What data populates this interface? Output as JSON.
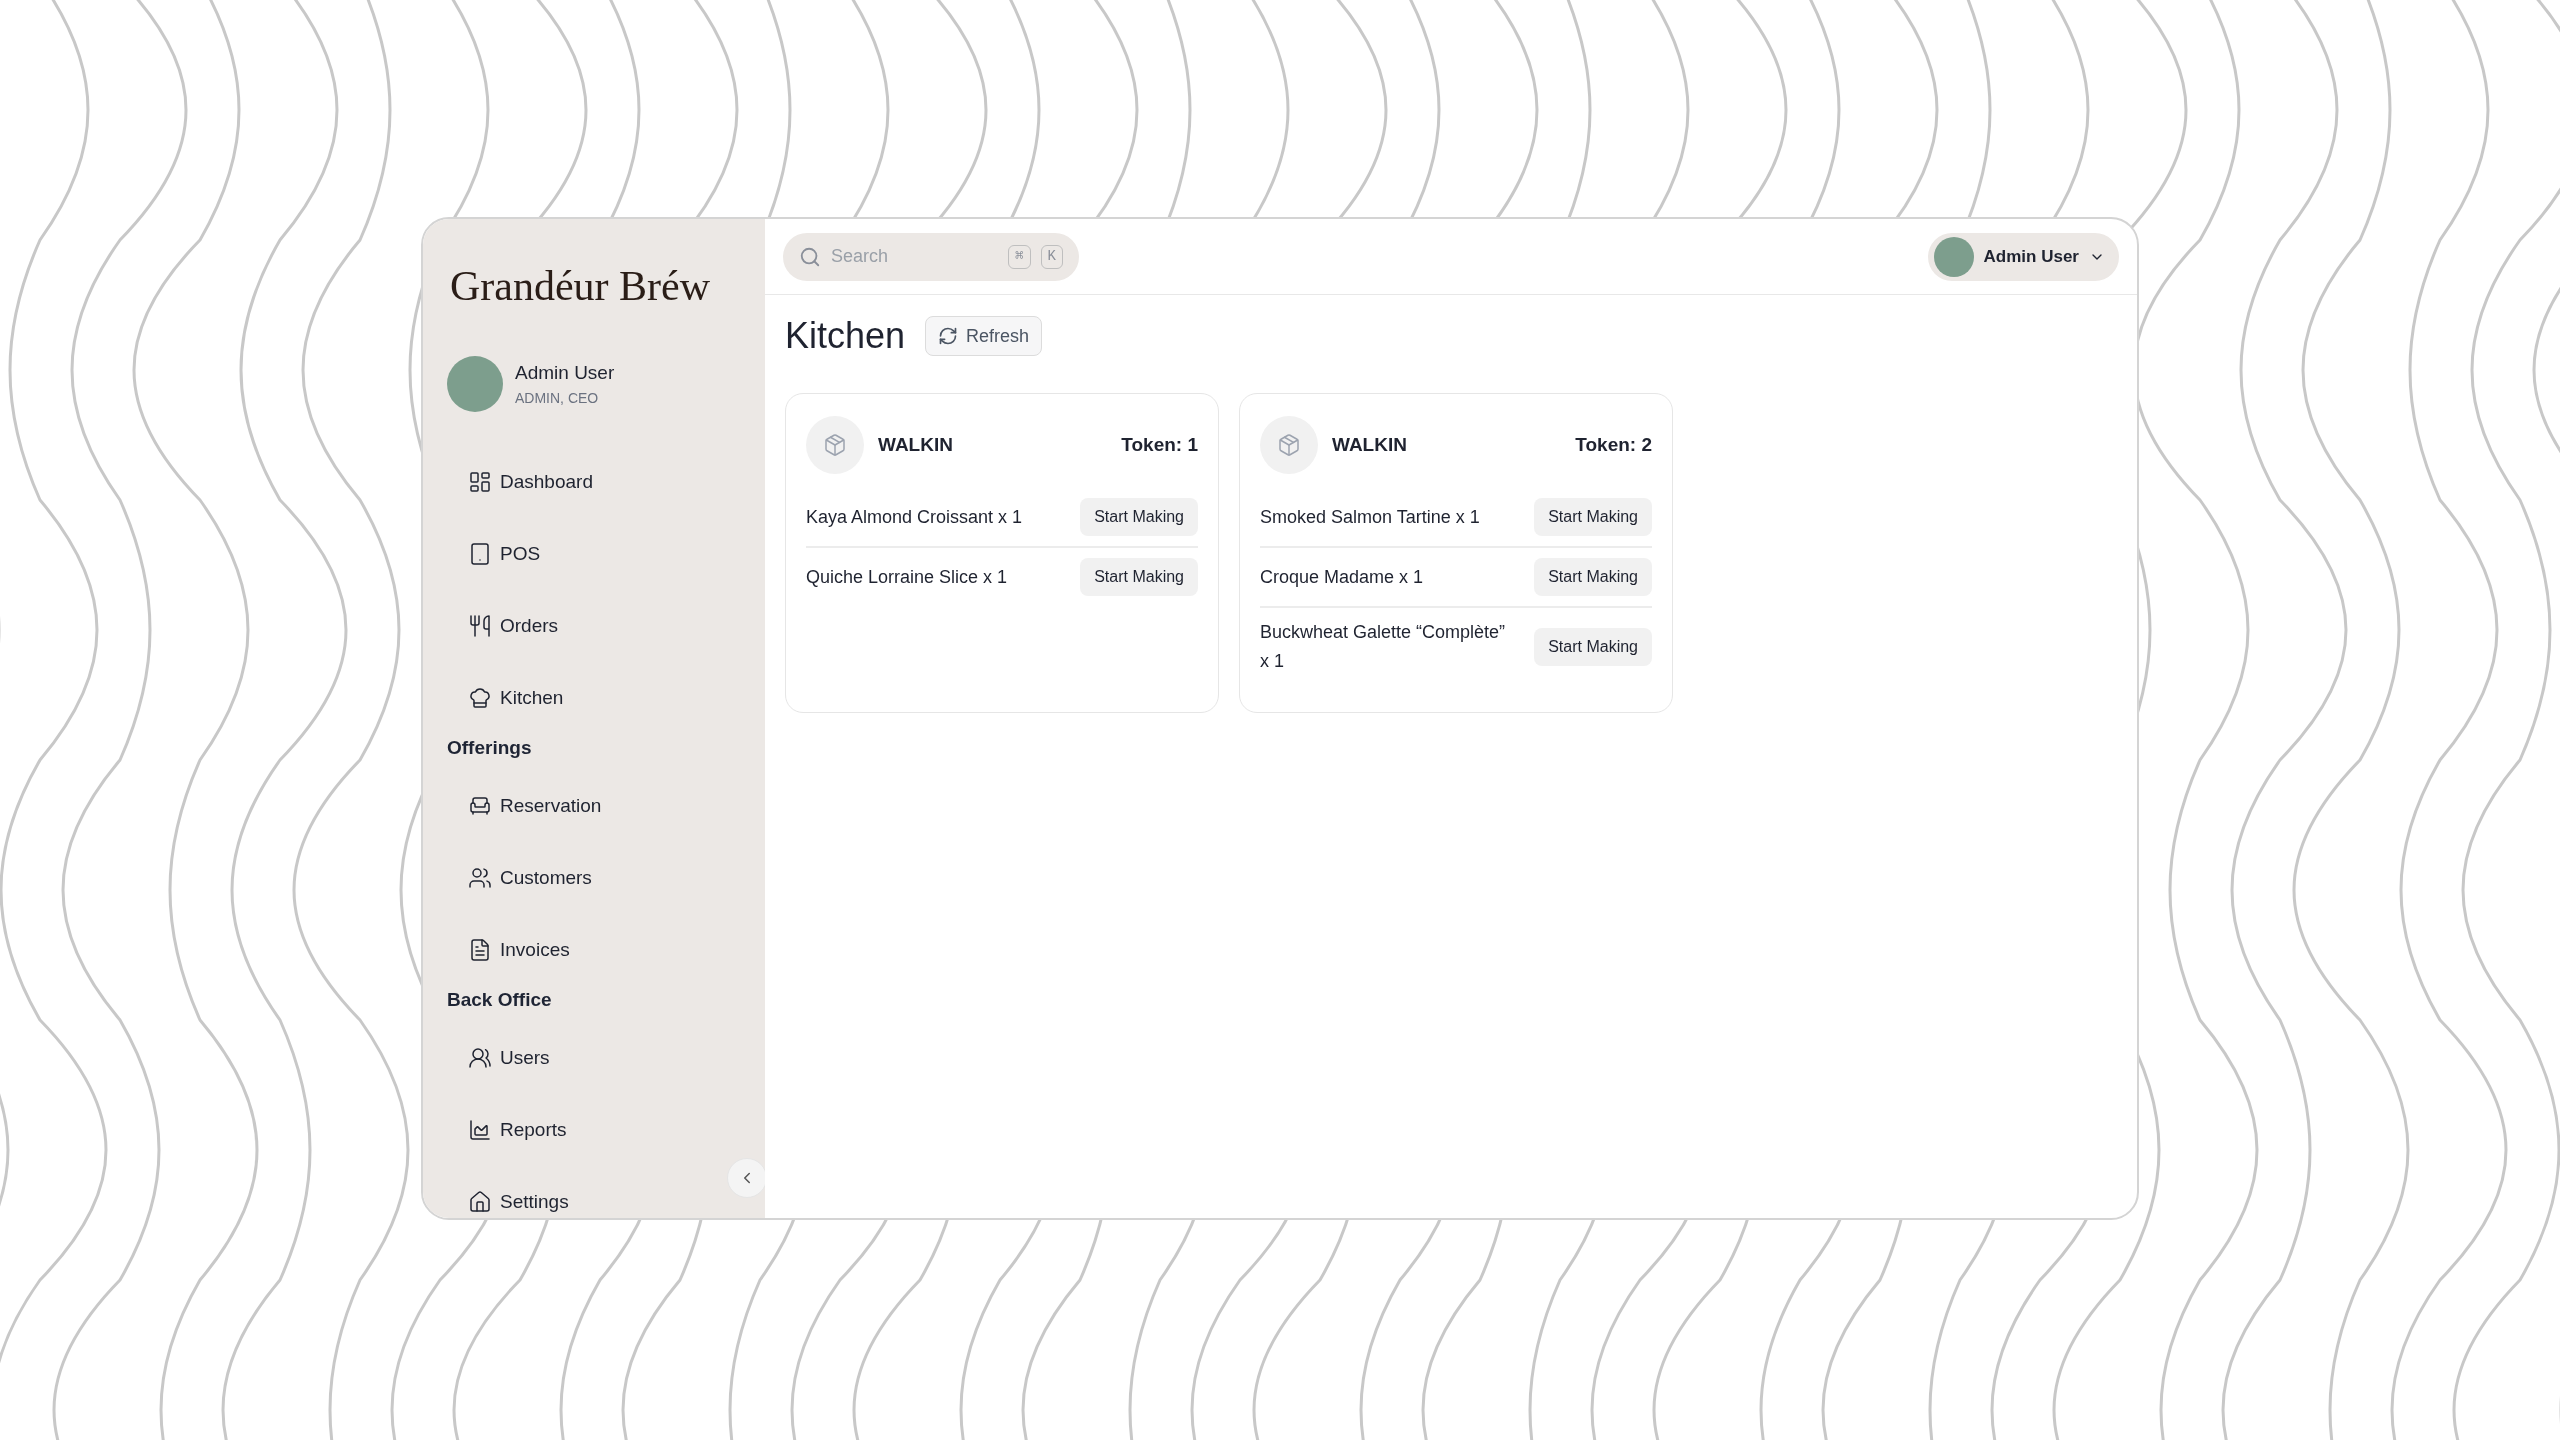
{
  "sidebar": {
    "logo": "Grandéur Bréw",
    "user": {
      "name": "Admin User",
      "role": "ADMIN, CEO"
    },
    "sections": [
      {
        "items": [
          "Dashboard",
          "POS",
          "Orders",
          "Kitchen"
        ]
      },
      {
        "heading": "Offerings",
        "items": [
          "Reservation",
          "Customers",
          "Invoices"
        ]
      },
      {
        "heading": "Back Office",
        "items": [
          "Users",
          "Reports",
          "Settings"
        ]
      }
    ]
  },
  "topbar": {
    "search": {
      "placeholder": "Search",
      "keys": [
        "⌘",
        "K"
      ]
    },
    "user": {
      "name": "Admin User"
    }
  },
  "page": {
    "title": "Kitchen",
    "refresh": "Refresh"
  },
  "orders": [
    {
      "type": "WALKIN",
      "token": "Token: 1",
      "items": [
        {
          "name": "Kaya Almond Croissant x 1",
          "action": "Start Making"
        },
        {
          "name": "Quiche Lorraine Slice x 1",
          "action": "Start Making"
        }
      ]
    },
    {
      "type": "WALKIN",
      "token": "Token: 2",
      "items": [
        {
          "name": "Smoked Salmon Tartine x 1",
          "action": "Start Making"
        },
        {
          "name": "Croque Madame x 1",
          "action": "Start Making"
        },
        {
          "name": "Buckwheat Galette “Complète” x 1",
          "action": "Start Making"
        }
      ]
    }
  ]
}
